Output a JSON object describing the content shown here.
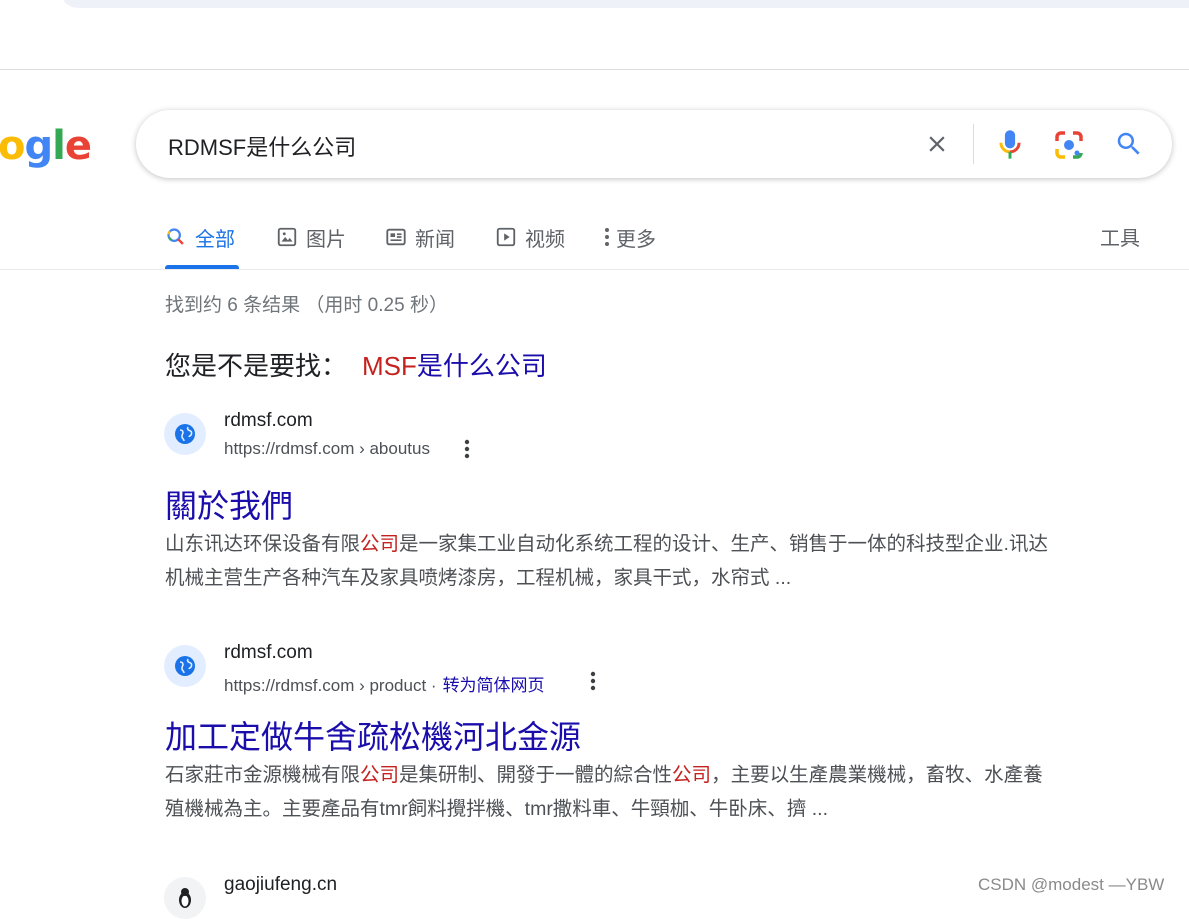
{
  "logo": {
    "text": "ogle"
  },
  "search": {
    "query": "RDMSF是什么公司"
  },
  "tabs": [
    {
      "label": "全部",
      "icon": "search-icon",
      "active": true
    },
    {
      "label": "图片",
      "icon": "image-icon"
    },
    {
      "label": "新闻",
      "icon": "news-icon"
    },
    {
      "label": "视频",
      "icon": "video-icon"
    },
    {
      "label": "更多",
      "icon": "more-vert-icon"
    }
  ],
  "tools_label": "工具",
  "stats": "找到约 6 条结果 （用时 0.25 秒）",
  "did_you_mean": {
    "prefix": "您是不是要找：",
    "highlight": "MSF",
    "rest": "是什么公司"
  },
  "results": [
    {
      "site_name": "rdmsf.com",
      "cite": "https://rdmsf.com › aboutus",
      "title": "關於我們",
      "snippet_1": "山东讯达环保设备有限",
      "snippet_em": "公司",
      "snippet_2": "是一家集工业自动化系统工程的设计、生产、销售于一体的科技型企业.讯达机械主营生产各种汽车及家具喷烤漆房，工程机械，家具干式，水帘式 ..."
    },
    {
      "site_name": "rdmsf.com",
      "cite": "https://rdmsf.com › product ·",
      "translate": "转为简体网页",
      "title": "加工定做牛舍疏松機河北金源",
      "snippet_1": "石家莊市金源機械有限",
      "snippet_em": "公司",
      "snippet_2": "是集研制、開發于一體的綜合性",
      "snippet_em2": "公司",
      "snippet_3": "，主要以生產農業機械，畜牧、水產養殖機械為主。主要產品有tmr飼料攪拌機、tmr撒料車、牛頸枷、牛卧床、擠 ..."
    },
    {
      "site_name": "gaojiufeng.cn"
    }
  ],
  "watermark": "CSDN @modest —YBW",
  "colors": {
    "link": "#1a0dab",
    "accent": "#1a73e8",
    "highlight": "#c5221f"
  }
}
